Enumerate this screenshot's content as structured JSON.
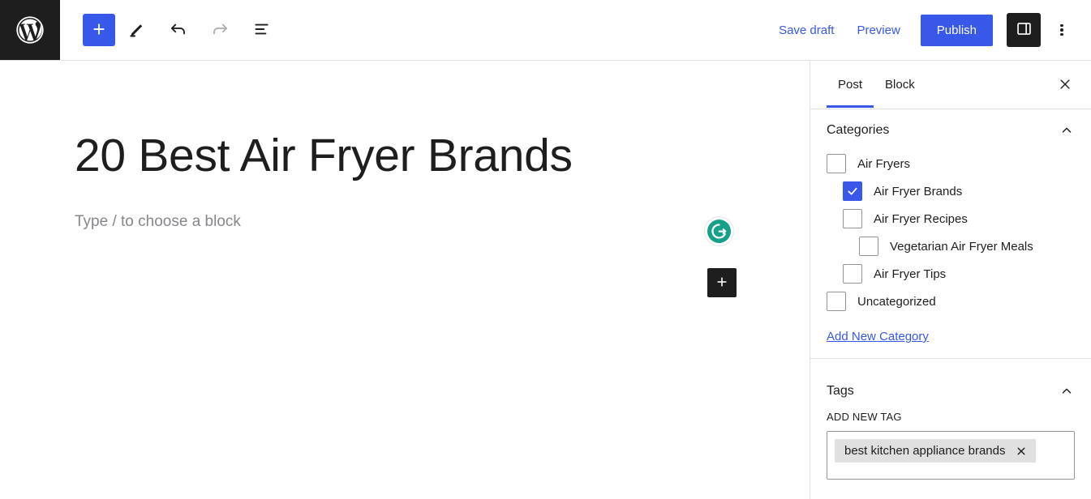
{
  "toolbar": {
    "logo_icon": "wordpress-logo-icon",
    "add_block_label": "+",
    "tools": [
      {
        "name": "add-block-button",
        "icon": "plus-icon"
      },
      {
        "name": "edit-tool-button",
        "icon": "pencil-icon"
      },
      {
        "name": "undo-button",
        "icon": "undo-arrow-icon"
      },
      {
        "name": "redo-button",
        "icon": "redo-arrow-icon"
      },
      {
        "name": "list-view-button",
        "icon": "document-overview-icon"
      }
    ],
    "save_draft_label": "Save draft",
    "preview_label": "Preview",
    "publish_label": "Publish",
    "sidebar_toggle_icon": "settings-panel-icon",
    "options_icon": "vertical-ellipsis-icon",
    "accent_color": "#3858e9",
    "dark_color": "#1e1e1e"
  },
  "editor": {
    "post_title": "20 Best Air Fryer Brands",
    "block_placeholder": "Type / to choose a block",
    "grammarly_icon": "grammarly-logo-icon",
    "grammarly_color": "#15a08a",
    "inline_inserter_icon": "plus-icon"
  },
  "sidebar": {
    "tabs": [
      {
        "label": "Post",
        "active": true
      },
      {
        "label": "Block",
        "active": false
      }
    ],
    "close_icon": "close-icon",
    "categories_panel": {
      "title": "Categories",
      "collapse_icon": "chevron-up-icon",
      "items": [
        {
          "label": "Air Fryers",
          "checked": false,
          "level": 0
        },
        {
          "label": "Air Fryer Brands",
          "checked": true,
          "level": 1
        },
        {
          "label": "Air Fryer Recipes",
          "checked": false,
          "level": 1
        },
        {
          "label": "Vegetarian Air Fryer Meals",
          "checked": false,
          "level": 2
        },
        {
          "label": "Air Fryer Tips",
          "checked": false,
          "level": 1
        },
        {
          "label": "Uncategorized",
          "checked": false,
          "level": 0
        }
      ],
      "add_new_label": "Add New Category"
    },
    "tags_panel": {
      "title": "Tags",
      "collapse_icon": "chevron-up-icon",
      "add_new_tag_label": "ADD NEW TAG",
      "tags": [
        {
          "label": "best kitchen appliance brands",
          "remove_icon": "close-icon"
        }
      ]
    }
  }
}
